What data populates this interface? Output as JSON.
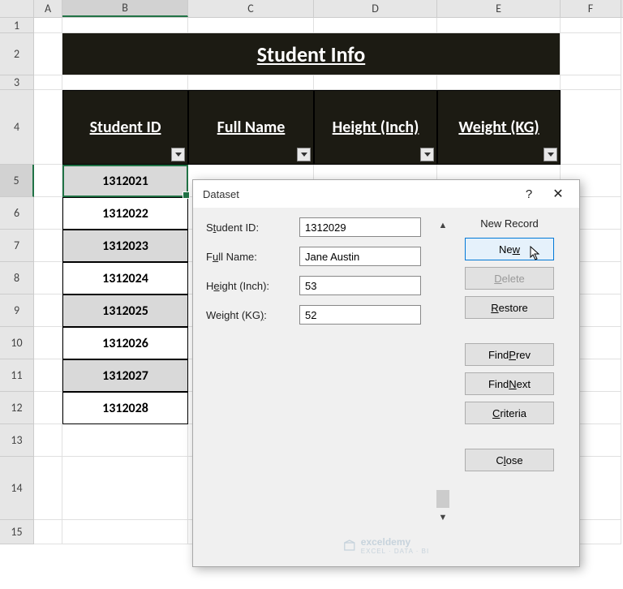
{
  "columns": [
    "A",
    "B",
    "C",
    "D",
    "E",
    "F"
  ],
  "rows": [
    "1",
    "2",
    "3",
    "4",
    "5",
    "6",
    "7",
    "8",
    "9",
    "10",
    "11",
    "12",
    "13",
    "14",
    "15"
  ],
  "selected_cell": "B5",
  "title": "Student Info",
  "headers": {
    "student_id": "Student ID",
    "full_name": "Full Name",
    "height": "Height (Inch)",
    "weight": "Weight (KG)"
  },
  "data_rows": [
    {
      "id": "1312021"
    },
    {
      "id": "1312022"
    },
    {
      "id": "1312023"
    },
    {
      "id": "1312024"
    },
    {
      "id": "1312025"
    },
    {
      "id": "1312026"
    },
    {
      "id": "1312027"
    },
    {
      "id": "1312028"
    }
  ],
  "dialog": {
    "title": "Dataset",
    "help": "?",
    "close": "✕",
    "status": "New Record",
    "fields": {
      "student_id": {
        "label_pre": "S",
        "label_u": "t",
        "label_post": "udent ID:",
        "value": "1312029"
      },
      "full_name": {
        "label_pre": "F",
        "label_u": "u",
        "label_post": "ll Name:",
        "value": "Jane Austin"
      },
      "height": {
        "label_pre": "H",
        "label_u": "e",
        "label_post": "ight (Inch):",
        "value": "53"
      },
      "weight": {
        "label_pre": "Weight (KG",
        "label_u": ")",
        "label_post": ":",
        "value": "52"
      }
    },
    "buttons": {
      "new_pre": "Ne",
      "new_u": "w",
      "delete_pre": "",
      "delete_u": "D",
      "delete_post": "elete",
      "restore_pre": "",
      "restore_u": "R",
      "restore_post": "estore",
      "findprev_pre": "Find ",
      "findprev_u": "P",
      "findprev_post": "rev",
      "findnext_pre": "Find ",
      "findnext_u": "N",
      "findnext_post": "ext",
      "criteria_pre": "",
      "criteria_u": "C",
      "criteria_post": "riteria",
      "close_pre": "C",
      "close_u": "l",
      "close_post": "ose"
    }
  },
  "watermark": {
    "brand": "exceldemy",
    "tag": "EXCEL · DATA · BI"
  }
}
